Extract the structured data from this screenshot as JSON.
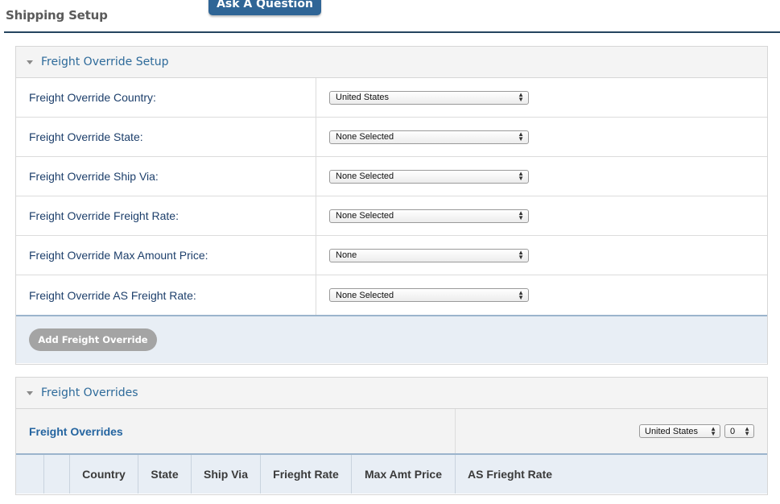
{
  "header": {
    "title": "Shipping Setup",
    "ask_button": "Ask A Question"
  },
  "setup_panel": {
    "title": "Freight Override Setup",
    "rows": [
      {
        "label": "Freight Override Country:",
        "value": "United States"
      },
      {
        "label": "Freight Override State:",
        "value": "None Selected"
      },
      {
        "label": "Freight Override Ship Via:",
        "value": "None Selected"
      },
      {
        "label": "Freight Override Freight Rate:",
        "value": "None Selected"
      },
      {
        "label": "Freight Override Max Amount Price:",
        "value": "None"
      },
      {
        "label": "Freight Override AS Freight Rate:",
        "value": "None Selected"
      }
    ],
    "add_button": "Add Freight Override"
  },
  "overrides_panel": {
    "title": "Freight Overrides",
    "list_title": "Freight Overrides",
    "country_filter": "United States",
    "count_filter": "0",
    "columns": [
      "",
      "",
      "Country",
      "State",
      "Ship Via",
      "Frieght Rate",
      "Max Amt Price",
      "AS Frieght Rate"
    ]
  },
  "colors": {
    "accent": "#2f6596",
    "header_rule": "#25455f",
    "label_text": "#1d3f6b",
    "footer_bg": "#e8eef5"
  }
}
